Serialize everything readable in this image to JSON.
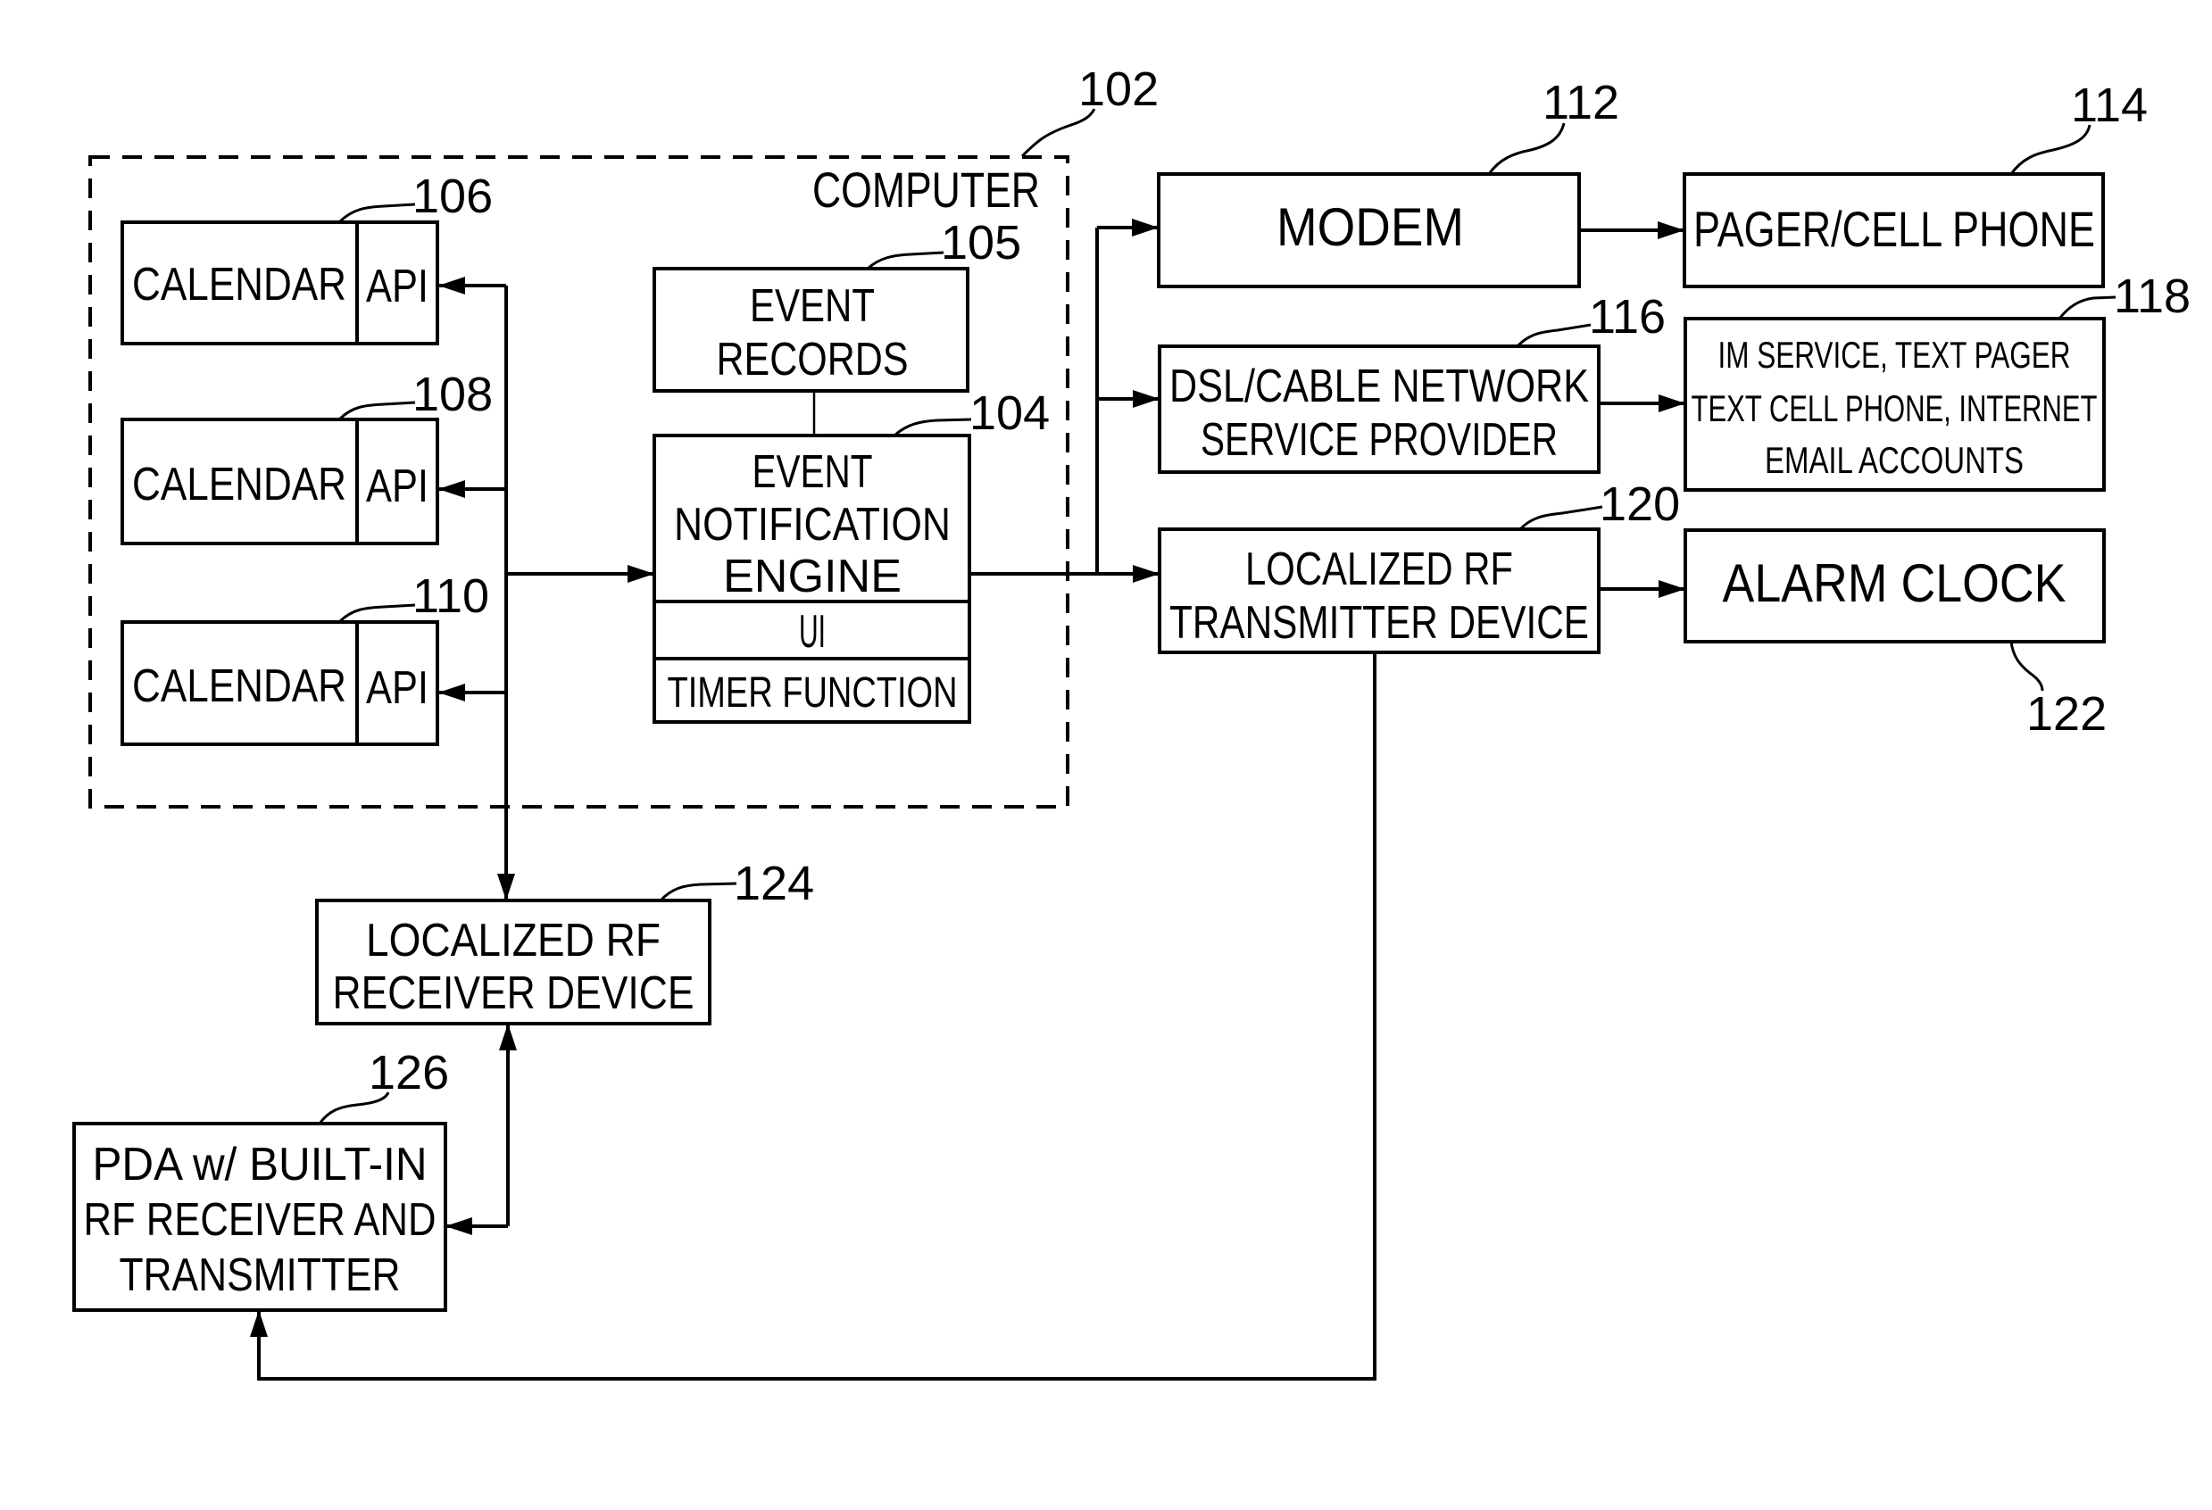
{
  "figure": {
    "computer": {
      "label": "COMPUTER",
      "ref": "102"
    },
    "calendars": [
      {
        "label": "CALENDAR",
        "api": "API",
        "ref": "106"
      },
      {
        "label": "CALENDAR",
        "api": "API",
        "ref": "108"
      },
      {
        "label": "CALENDAR",
        "api": "API",
        "ref": "110"
      }
    ],
    "event_records": {
      "lines": [
        "EVENT",
        "RECORDS"
      ],
      "ref": "105"
    },
    "engine": {
      "lines": [
        "EVENT",
        "NOTIFICATION",
        "ENGINE"
      ],
      "ui": "UI",
      "timer": "TIMER FUNCTION",
      "ref": "104"
    },
    "modem": {
      "label": "MODEM",
      "ref": "112"
    },
    "pager": {
      "label": "PAGER/CELL PHONE",
      "ref": "114"
    },
    "dsl": {
      "lines": [
        "DSL/CABLE NETWORK",
        "SERVICE PROVIDER"
      ],
      "ref": "116"
    },
    "im": {
      "lines": [
        "IM SERVICE, TEXT PAGER",
        "TEXT CELL PHONE, INTERNET",
        "EMAIL ACCOUNTS"
      ],
      "ref": "118"
    },
    "transmitter": {
      "lines": [
        "LOCALIZED RF",
        "TRANSMITTER DEVICE"
      ],
      "ref": "120"
    },
    "alarm": {
      "label": "ALARM CLOCK",
      "ref": "122"
    },
    "receiver": {
      "lines": [
        "LOCALIZED RF",
        "RECEIVER DEVICE"
      ],
      "ref": "124"
    },
    "pda": {
      "lines": [
        "PDA  w/ BUILT-IN",
        "RF RECEIVER AND",
        "TRANSMITTER"
      ],
      "ref": "126"
    }
  }
}
